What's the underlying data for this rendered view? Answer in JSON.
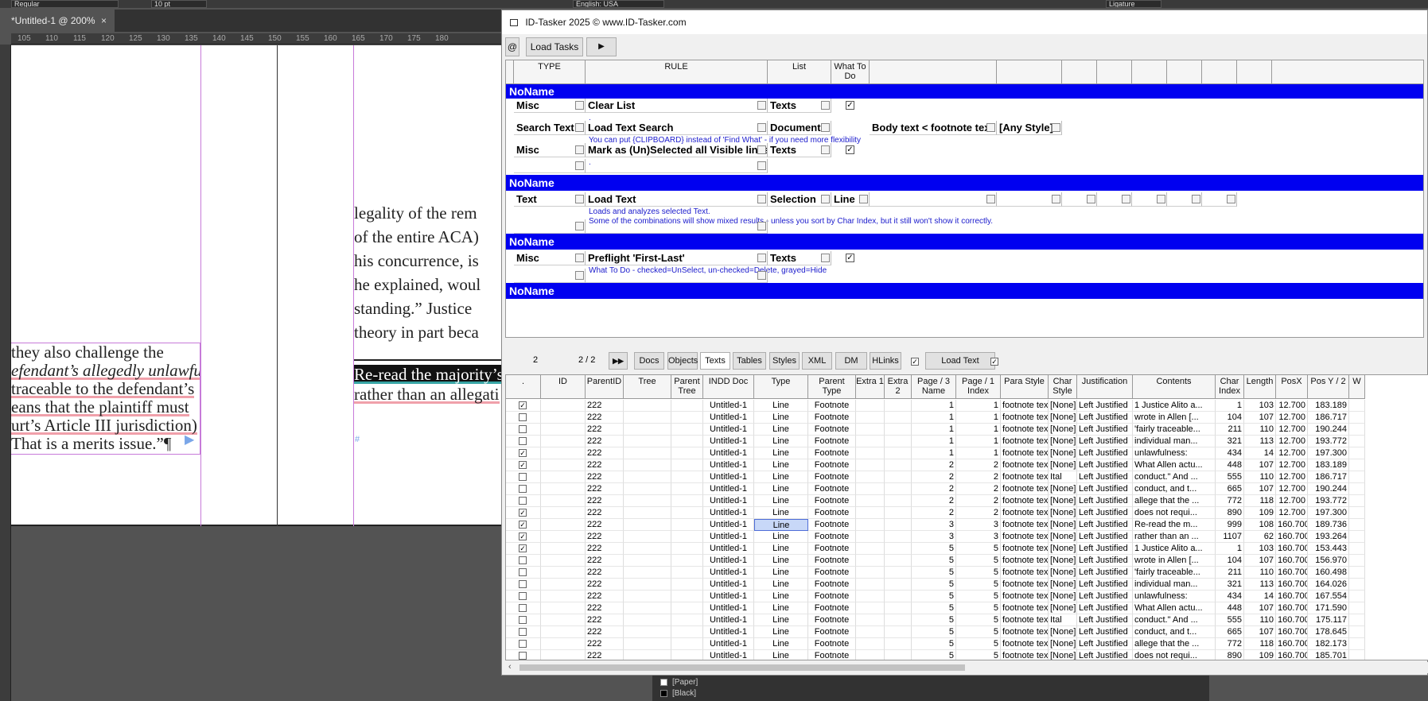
{
  "topbar": {
    "font_style": "Regular",
    "size": "10 pt",
    "language": "English: USA",
    "ligature": "Ligature"
  },
  "document": {
    "tab_title": "*Untitled-1 @ 200%",
    "close_glyph": "×"
  },
  "ruler": {
    "ticks": [
      "105",
      "110",
      "115",
      "120",
      "125",
      "130",
      "135",
      "140",
      "145",
      "150",
      "155",
      "160",
      "165",
      "170",
      "175",
      "180"
    ]
  },
  "page_text": {
    "left_frame": [
      "they also challenge the",
      "efendant’s allegedly unlawful",
      "traceable to the defendant’s",
      "eans that the plaintiff must",
      "urt’s Article III jurisdiction)",
      "That is a merits issue.”¶"
    ],
    "right_frame": [
      "legality of the rem",
      "of the entire ACA)",
      "his concurrence, is",
      "he explained, woul",
      "standing.” Justice",
      "theory in part beca"
    ],
    "right_footnote": [
      "Re-read the majority’s",
      "rather than an allegati"
    ],
    "hash": "#"
  },
  "window": {
    "title": "ID-Tasker 2025   © www.ID-Tasker.com",
    "at_label": "@",
    "load_tasks": "Load Tasks",
    "play_glyph": "▶"
  },
  "rules": {
    "headers": [
      "TYPE",
      "RULE",
      "List",
      "What To Do"
    ],
    "groups": [
      {
        "name": "NoName"
      },
      {
        "name": "NoName"
      },
      {
        "name": "NoName"
      },
      {
        "name": "NoName"
      }
    ],
    "rows": [
      {
        "type": "Misc",
        "rule": "Clear List",
        "list": "Texts",
        "note": "."
      },
      {
        "type": "Search Text",
        "rule": "Load Text Search",
        "list": "Document",
        "extra1": "Body text < footnote text",
        "extra2": "[Any Style]",
        "note": "You can put {CLIPBOARD} instead of 'Find What' - if you need more flexibility"
      },
      {
        "type": "Misc",
        "rule": "Mark as (Un)Selected all Visible lines",
        "list": "Texts",
        "note": "."
      },
      {
        "type": "Text",
        "rule": "Load Text",
        "list": "Selection",
        "what": "Line",
        "note": "Loads and analyzes selected Text.",
        "note2": "Some of the combinations will show mixed results - unless you sort by Char Index, but it still won't show it correctly."
      },
      {
        "type": "Misc",
        "rule": "Preflight 'First-Last'",
        "list": "Texts",
        "note": "What To Do - checked=UnSelect, un-checked=Delete, grayed=Hide"
      }
    ],
    "check_glyph": "✓"
  },
  "gridbar": {
    "count": "2",
    "pages": "2 / 2",
    "ffwd": "▶▶",
    "tabs": [
      "Docs",
      "Objects",
      "Texts",
      "Tables",
      "Styles",
      "XML",
      "DM",
      "HLinks"
    ],
    "active_tab": "Texts",
    "load_text": "Load Text"
  },
  "grid": {
    "headers": [
      ".",
      "ID",
      "ParentID",
      "Tree",
      "Parent Tree",
      "INDD Doc",
      "Type",
      "Parent Type",
      "Extra 1",
      "Extra 2",
      "Page / 3 Name",
      "Page / 1 Index",
      "Para Style",
      "Char Style",
      "Justification",
      "Contents",
      "Char Index",
      "Length",
      "PosX",
      "Pos Y / 2",
      "W"
    ],
    "rows": [
      {
        "chk": true,
        "parent": "222",
        "doc": "Untitled-1",
        "type": "Line",
        "ptype": "Footnote",
        "pname": "1",
        "pidx": "1",
        "para": "footnote text",
        "char": "[None]",
        "just": "Left Justified",
        "contents": "1 Justice Alito a...",
        "cidx": "1",
        "len": "103",
        "x": "12.700",
        "y": "183.189"
      },
      {
        "chk": false,
        "parent": "222",
        "doc": "Untitled-1",
        "type": "Line",
        "ptype": "Footnote",
        "pname": "1",
        "pidx": "1",
        "para": "footnote text",
        "char": "[None]",
        "just": "Left Justified",
        "contents": "wrote in Allen [...",
        "cidx": "104",
        "len": "107",
        "x": "12.700",
        "y": "186.717"
      },
      {
        "chk": false,
        "parent": "222",
        "doc": "Untitled-1",
        "type": "Line",
        "ptype": "Footnote",
        "pname": "1",
        "pidx": "1",
        "para": "footnote text",
        "char": "[None]",
        "just": "Left Justified",
        "contents": "'fairly traceable...",
        "cidx": "211",
        "len": "110",
        "x": "12.700",
        "y": "190.244"
      },
      {
        "chk": false,
        "parent": "222",
        "doc": "Untitled-1",
        "type": "Line",
        "ptype": "Footnote",
        "pname": "1",
        "pidx": "1",
        "para": "footnote text",
        "char": "[None]",
        "just": "Left Justified",
        "contents": "individual man...",
        "cidx": "321",
        "len": "113",
        "x": "12.700",
        "y": "193.772"
      },
      {
        "chk": true,
        "parent": "222",
        "doc": "Untitled-1",
        "type": "Line",
        "ptype": "Footnote",
        "pname": "1",
        "pidx": "1",
        "para": "footnote text",
        "char": "[None]",
        "just": "Left Justified",
        "contents": "unlawfulness:",
        "cidx": "434",
        "len": "14",
        "x": "12.700",
        "y": "197.300"
      },
      {
        "chk": true,
        "parent": "222",
        "doc": "Untitled-1",
        "type": "Line",
        "ptype": "Footnote",
        "pname": "2",
        "pidx": "2",
        "para": "footnote text",
        "char": "[None]",
        "just": "Left Justified",
        "contents": "What Allen actu...",
        "cidx": "448",
        "len": "107",
        "x": "12.700",
        "y": "183.189"
      },
      {
        "chk": false,
        "parent": "222",
        "doc": "Untitled-1",
        "type": "Line",
        "ptype": "Footnote",
        "pname": "2",
        "pidx": "2",
        "para": "footnote text",
        "char": "Ital",
        "just": "Left Justified",
        "contents": "conduct.\" And ...",
        "cidx": "555",
        "len": "110",
        "x": "12.700",
        "y": "186.717"
      },
      {
        "chk": false,
        "parent": "222",
        "doc": "Untitled-1",
        "type": "Line",
        "ptype": "Footnote",
        "pname": "2",
        "pidx": "2",
        "para": "footnote text",
        "char": "[None]",
        "just": "Left Justified",
        "contents": "conduct, and t...",
        "cidx": "665",
        "len": "107",
        "x": "12.700",
        "y": "190.244"
      },
      {
        "chk": false,
        "parent": "222",
        "doc": "Untitled-1",
        "type": "Line",
        "ptype": "Footnote",
        "pname": "2",
        "pidx": "2",
        "para": "footnote text",
        "char": "[None]",
        "just": "Left Justified",
        "contents": "allege that the ...",
        "cidx": "772",
        "len": "118",
        "x": "12.700",
        "y": "193.772"
      },
      {
        "chk": true,
        "parent": "222",
        "doc": "Untitled-1",
        "type": "Line",
        "ptype": "Footnote",
        "pname": "2",
        "pidx": "2",
        "para": "footnote text",
        "char": "[None]",
        "just": "Left Justified",
        "contents": "does not requi...",
        "cidx": "890",
        "len": "109",
        "x": "12.700",
        "y": "197.300"
      },
      {
        "chk": true,
        "parent": "222",
        "doc": "Untitled-1",
        "type": "Line",
        "ptype": "Footnote",
        "pname": "3",
        "pidx": "3",
        "para": "footnote text",
        "char": "[None]",
        "just": "Left Justified",
        "contents": "Re-read the m...",
        "cidx": "999",
        "len": "108",
        "x": "160.700",
        "y": "189.736",
        "sel": true
      },
      {
        "chk": true,
        "parent": "222",
        "doc": "Untitled-1",
        "type": "Line",
        "ptype": "Footnote",
        "pname": "3",
        "pidx": "3",
        "para": "footnote text",
        "char": "[None]",
        "just": "Left Justified",
        "contents": "rather than an ...",
        "cidx": "1107",
        "len": "62",
        "x": "160.700",
        "y": "193.264"
      },
      {
        "chk": true,
        "parent": "222",
        "doc": "Untitled-1",
        "type": "Line",
        "ptype": "Footnote",
        "pname": "5",
        "pidx": "5",
        "para": "footnote text",
        "char": "[None]",
        "just": "Left Justified",
        "contents": "1 Justice Alito a...",
        "cidx": "1",
        "len": "103",
        "x": "160.700",
        "y": "153.443"
      },
      {
        "chk": false,
        "parent": "222",
        "doc": "Untitled-1",
        "type": "Line",
        "ptype": "Footnote",
        "pname": "5",
        "pidx": "5",
        "para": "footnote text",
        "char": "[None]",
        "just": "Left Justified",
        "contents": "wrote in Allen [...",
        "cidx": "104",
        "len": "107",
        "x": "160.700",
        "y": "156.970"
      },
      {
        "chk": false,
        "parent": "222",
        "doc": "Untitled-1",
        "type": "Line",
        "ptype": "Footnote",
        "pname": "5",
        "pidx": "5",
        "para": "footnote text",
        "char": "[None]",
        "just": "Left Justified",
        "contents": "'fairly traceable...",
        "cidx": "211",
        "len": "110",
        "x": "160.700",
        "y": "160.498"
      },
      {
        "chk": false,
        "parent": "222",
        "doc": "Untitled-1",
        "type": "Line",
        "ptype": "Footnote",
        "pname": "5",
        "pidx": "5",
        "para": "footnote text",
        "char": "[None]",
        "just": "Left Justified",
        "contents": "individual man...",
        "cidx": "321",
        "len": "113",
        "x": "160.700",
        "y": "164.026"
      },
      {
        "chk": false,
        "parent": "222",
        "doc": "Untitled-1",
        "type": "Line",
        "ptype": "Footnote",
        "pname": "5",
        "pidx": "5",
        "para": "footnote text",
        "char": "[None]",
        "just": "Left Justified",
        "contents": "unlawfulness:",
        "cidx": "434",
        "len": "14",
        "x": "160.700",
        "y": "167.554"
      },
      {
        "chk": false,
        "parent": "222",
        "doc": "Untitled-1",
        "type": "Line",
        "ptype": "Footnote",
        "pname": "5",
        "pidx": "5",
        "para": "footnote text",
        "char": "[None]",
        "just": "Left Justified",
        "contents": "What Allen actu...",
        "cidx": "448",
        "len": "107",
        "x": "160.700",
        "y": "171.590"
      },
      {
        "chk": false,
        "parent": "222",
        "doc": "Untitled-1",
        "type": "Line",
        "ptype": "Footnote",
        "pname": "5",
        "pidx": "5",
        "para": "footnote text",
        "char": "Ital",
        "just": "Left Justified",
        "contents": "conduct.\" And ...",
        "cidx": "555",
        "len": "110",
        "x": "160.700",
        "y": "175.117"
      },
      {
        "chk": false,
        "parent": "222",
        "doc": "Untitled-1",
        "type": "Line",
        "ptype": "Footnote",
        "pname": "5",
        "pidx": "5",
        "para": "footnote text",
        "char": "[None]",
        "just": "Left Justified",
        "contents": "conduct, and t...",
        "cidx": "665",
        "len": "107",
        "x": "160.700",
        "y": "178.645"
      },
      {
        "chk": false,
        "parent": "222",
        "doc": "Untitled-1",
        "type": "Line",
        "ptype": "Footnote",
        "pname": "5",
        "pidx": "5",
        "para": "footnote text",
        "char": "[None]",
        "just": "Left Justified",
        "contents": "allege that the ...",
        "cidx": "772",
        "len": "118",
        "x": "160.700",
        "y": "182.173"
      },
      {
        "chk": false,
        "parent": "222",
        "doc": "Untitled-1",
        "type": "Line",
        "ptype": "Footnote",
        "pname": "5",
        "pidx": "5",
        "para": "footnote text",
        "char": "[None]",
        "just": "Left Justified",
        "contents": "does not requi...",
        "cidx": "890",
        "len": "109",
        "x": "160.700",
        "y": "185.701"
      }
    ]
  },
  "swatches": {
    "items": [
      {
        "label": "[Paper]",
        "color": "#ffffff"
      },
      {
        "label": "[Black]",
        "color": "#000000"
      }
    ]
  },
  "colors": {
    "group_bar": "#0000f0",
    "accent_note": "#1a1acc",
    "selection": "#c8d8f8"
  }
}
